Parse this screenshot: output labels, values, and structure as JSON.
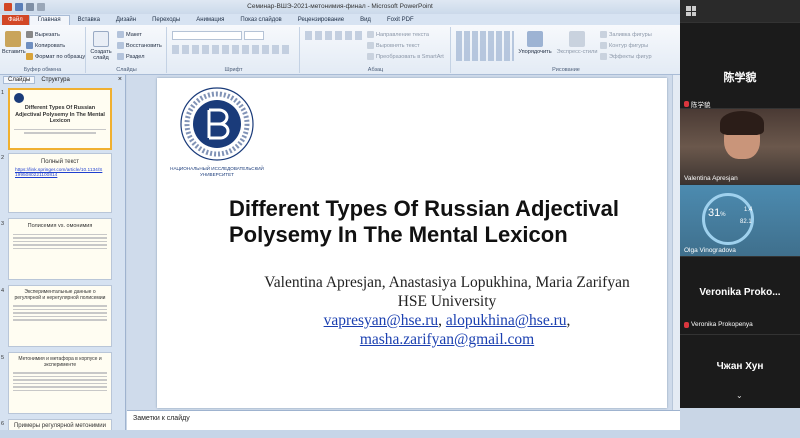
{
  "window": {
    "title": "Семинар-ВШЭ-2021-метонимия-финал - Microsoft PowerPoint"
  },
  "tabs": [
    {
      "label": "Файл"
    },
    {
      "label": "Главная"
    },
    {
      "label": "Вставка"
    },
    {
      "label": "Дизайн"
    },
    {
      "label": "Переходы"
    },
    {
      "label": "Анимация"
    },
    {
      "label": "Показ слайдов"
    },
    {
      "label": "Рецензирование"
    },
    {
      "label": "Вид"
    },
    {
      "label": "Foxit PDF"
    }
  ],
  "ribbon": {
    "clipboard": {
      "paste": "Вставить",
      "cut": "Вырезать",
      "copy": "Копировать",
      "format": "Формат по образцу",
      "label": "Буфер обмена"
    },
    "slides": {
      "new_slide": "Создать слайд",
      "layout": "Макет",
      "reset": "Восстановить",
      "section": "Раздел",
      "label": "Слайды"
    },
    "font": {
      "label": "Шрифт"
    },
    "paragraph": {
      "direction": "Направление текста",
      "align": "Выровнять текст",
      "smartart": "Преобразовать в SmartArt",
      "label": "Абзац"
    },
    "drawing": {
      "arrange": "Упорядочить",
      "quick_styles": "Экспресс-стили",
      "fill": "Заливка фигуры",
      "outline": "Контур фигуры",
      "effects": "Эффекты фигур",
      "label": "Рисование"
    }
  },
  "left_panel": {
    "tab_slides": "Слайды",
    "tab_outline": "Структура",
    "thumbs": [
      {
        "num": "1",
        "title": "Different Types Of Russian Adjectival Polysemy In The Mental Lexicon"
      },
      {
        "num": "2",
        "title": "Полный текст",
        "link": "https://link.springer.com/article/10.1134/S1995080221100814"
      },
      {
        "num": "3",
        "title": "Полисемия vs. омонимия"
      },
      {
        "num": "4",
        "title": "Экспериментальные данные о регулярной и нерегулярной полисемии"
      },
      {
        "num": "5",
        "title": "Метонимия и метафора в корпусе и эксперименте"
      },
      {
        "num": "6",
        "title": "Примеры регулярной метонимии"
      }
    ]
  },
  "slide": {
    "logo_text": "НАЦИОНАЛЬНЫЙ ИССЛЕДОВАТЕЛЬСКИЙ УНИВЕРСИТЕТ",
    "title_line1": "Different Types Of Russian Adjectival",
    "title_line2": "Polysemy In The Mental Lexicon",
    "authors": "Valentina Apresjan, Anastasiya Lopukhina, Maria Zarifyan",
    "affiliation": "HSE University",
    "email1": "vapresyan@hse.ru",
    "email_sep": ",",
    "email2": "alopukhina@hse.ru",
    "email_sep2": ",",
    "email3": "masha.zarifyan@gmail.com"
  },
  "notes": {
    "placeholder": "Заметки к слайду"
  },
  "video_panel": {
    "participant1": {
      "display_name": "陈学貌",
      "label": "陈学貌"
    },
    "participant2": {
      "label": "Valentina Apresjan"
    },
    "participant3": {
      "label": "Olga Vinogradova",
      "overlay_big": "31",
      "overlay_unit": "%",
      "overlay_top": "1.4",
      "overlay_mid": "82.1"
    },
    "participant4": {
      "display_name": "Veronika  Proko...",
      "label": "Veronika Prokopenya"
    },
    "participant5": {
      "display_name": "Чжан Хун"
    }
  },
  "colors": {
    "accent": "#d24726",
    "link": "#1a3fb0",
    "selection": "#f0b030"
  }
}
